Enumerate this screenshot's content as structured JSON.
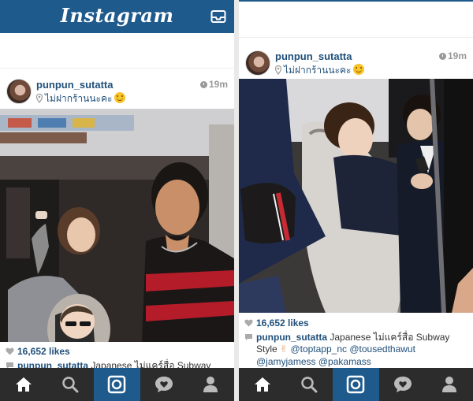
{
  "app": {
    "brand": "Instagram"
  },
  "left_post": {
    "username": "punpun_sutatta",
    "location": "ไม่ฝากร้านนะคะ",
    "time": "19m",
    "likes": "16,652 likes",
    "caption_user": "punpun_sutatta",
    "caption_text": "Japanese ไม่แคร์สื่อ Subway"
  },
  "right_post": {
    "username": "punpun_sutatta",
    "location": "ไม่ฝากร้านนะคะ",
    "time": "19m",
    "likes": "16,652 likes",
    "caption_user": "punpun_sutatta",
    "caption_text_1": "Japanese ไม่แคร์สื่อ Subway",
    "caption_text_2": "Style",
    "mention_1": "@toptapp_nc",
    "mention_2": "@tousedthawut",
    "mention_3": "@jamyjamess",
    "mention_4": "@pakamass"
  },
  "tabs": [
    {
      "name": "home",
      "active": false
    },
    {
      "name": "explore",
      "active": false
    },
    {
      "name": "camera",
      "active": true
    },
    {
      "name": "activity",
      "active": false
    },
    {
      "name": "profile",
      "active": false
    }
  ],
  "colors": {
    "brand_blue": "#1f5a8c",
    "tab_bg": "#2c2c2c",
    "link": "#1f4f7a"
  }
}
